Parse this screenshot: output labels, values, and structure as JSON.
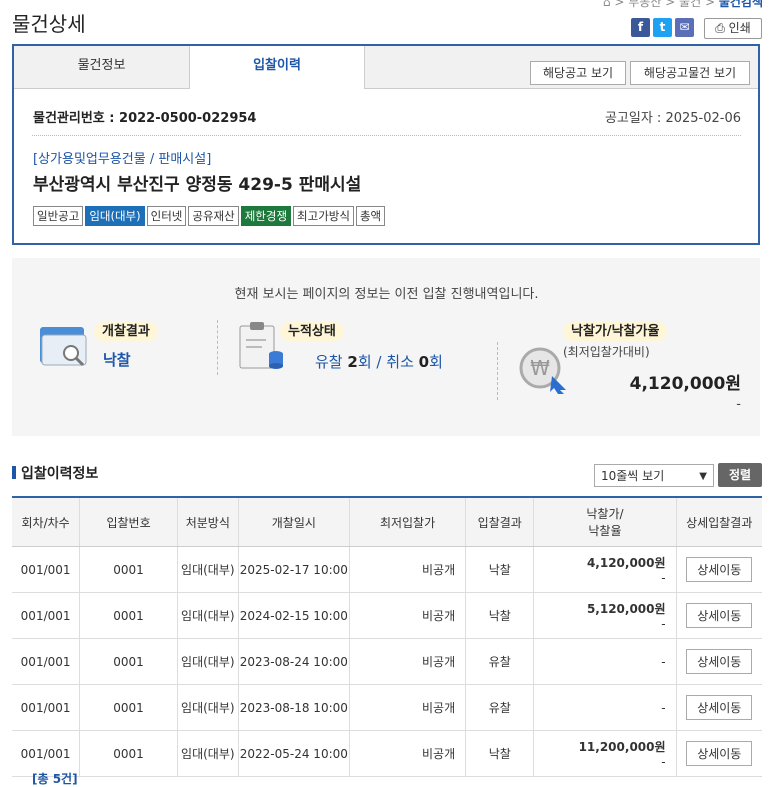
{
  "page_title": "물건상세",
  "breadcrumb": [
    "부동산",
    "물건",
    "물건검색"
  ],
  "print_label": "인쇄",
  "tabs": [
    {
      "label": "물건정보"
    },
    {
      "label": "입찰이력"
    }
  ],
  "top_buttons": [
    "해당공고 보기",
    "해당공고물건 보기"
  ],
  "item": {
    "id_label": "물건관리번호 :",
    "id_value": "2022-0500-022954",
    "date_label": "공고일자 :",
    "date_value": "2025-02-06",
    "category": "[상가용및업무용건물 / 판매시설]",
    "address": "부산광역시 부산진구 양정동 429-5 판매시설",
    "badges": [
      "일반공고",
      "임대(대부)",
      "인터넷",
      "공유재산",
      "제한경쟁",
      "최고가방식",
      "총액"
    ]
  },
  "summary": {
    "notice": "현재 보시는 페이지의 정보는 이전 입찰 진행내역입니다.",
    "open_result_label": "개찰결과",
    "open_result_value": "낙찰",
    "cumulative_label": "누적상태",
    "fail_label": "유찰",
    "fail_count": "2",
    "count_unit": "회",
    "slash": "/",
    "cancel_label": "취소",
    "cancel_count": "0",
    "price_label": "낙찰가/낙찰가율",
    "price_sub": "(최저입찰가대비)",
    "price_value": "4,120,000원",
    "rate_value": "-"
  },
  "history": {
    "title": "입찰이력정보",
    "page_size": "10줄씩 보기",
    "sort_label": "정렬",
    "columns": [
      "회차/차수",
      "입찰번호",
      "처분방식",
      "개찰일시",
      "최저입찰가",
      "입찰결과",
      "낙찰가/\n낙찰율",
      "상세입찰결과"
    ],
    "detail_label": "상세이동",
    "rows": [
      {
        "round": "001/001",
        "bid_no": "0001",
        "method": "임대(대부)",
        "date": "2025-02-17 10:00",
        "min_price": "비공개",
        "result": "낙찰",
        "price": "4,120,000원",
        "rate": "-"
      },
      {
        "round": "001/001",
        "bid_no": "0001",
        "method": "임대(대부)",
        "date": "2024-02-15 10:00",
        "min_price": "비공개",
        "result": "낙찰",
        "price": "5,120,000원",
        "rate": "-"
      },
      {
        "round": "001/001",
        "bid_no": "0001",
        "method": "임대(대부)",
        "date": "2023-08-24 10:00",
        "min_price": "비공개",
        "result": "유찰",
        "price": "",
        "rate": "-"
      },
      {
        "round": "001/001",
        "bid_no": "0001",
        "method": "임대(대부)",
        "date": "2023-08-18 10:00",
        "min_price": "비공개",
        "result": "유찰",
        "price": "",
        "rate": "-"
      },
      {
        "round": "001/001",
        "bid_no": "0001",
        "method": "임대(대부)",
        "date": "2022-05-24 10:00",
        "min_price": "비공개",
        "result": "낙찰",
        "price": "11,200,000원",
        "rate": "-"
      }
    ],
    "total": "[총 5건]"
  },
  "colors": {
    "accent": "#2f62a6",
    "link": "#1d56a8",
    "badge_blue": "#1d6fb8",
    "badge_green": "#1e7a3c"
  }
}
